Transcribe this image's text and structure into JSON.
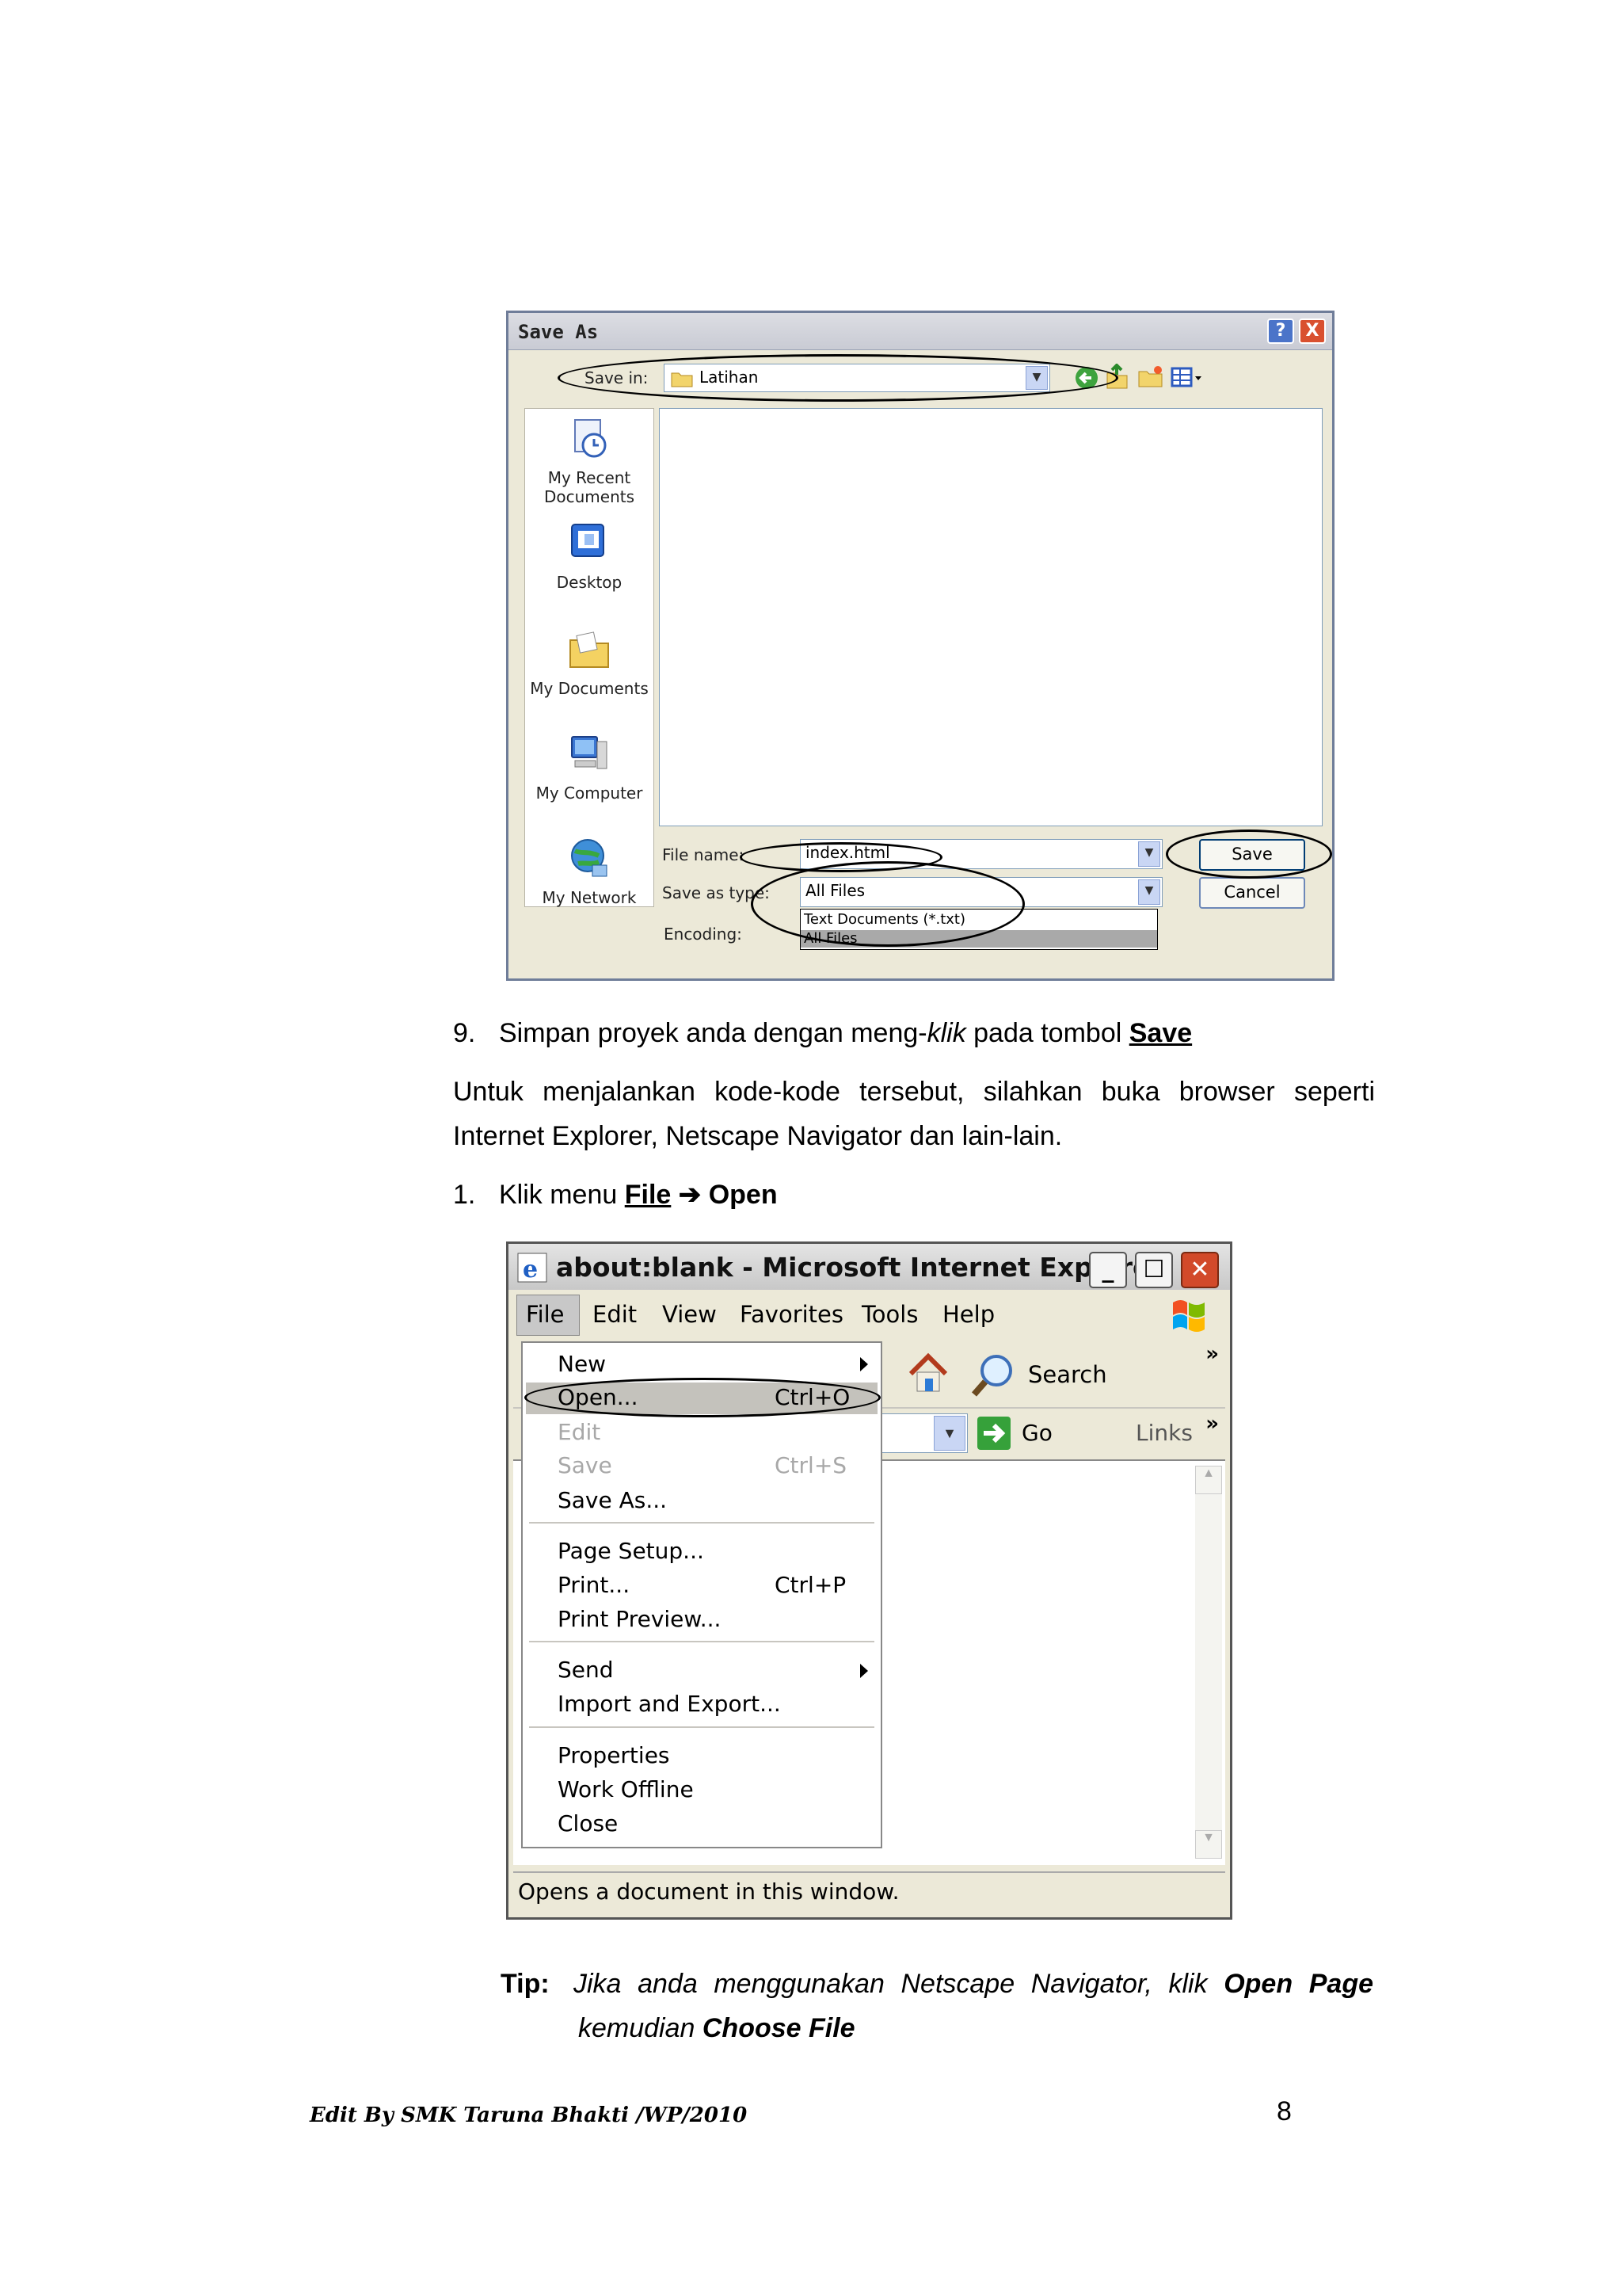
{
  "save_dialog": {
    "title": "Save As",
    "help_btn": "?",
    "close_btn": "X",
    "save_in_label": "Save in:",
    "save_in_value": "Latihan",
    "places": [
      {
        "line1": "My Recent",
        "line2": "Documents"
      },
      {
        "line1": "Desktop",
        "line2": ""
      },
      {
        "line1": "My Documents",
        "line2": ""
      },
      {
        "line1": "My Computer",
        "line2": ""
      },
      {
        "line1": "My Network",
        "line2": ""
      }
    ],
    "file_name_label": "File name:",
    "file_name_value": "index.html",
    "save_type_label": "Save as type:",
    "save_type_value": "All Files",
    "type_options": [
      "Text Documents (*.txt)",
      "All Files"
    ],
    "encoding_label": "Encoding:",
    "save_button": "Save",
    "cancel_button": "Cancel"
  },
  "text": {
    "step9_num": "9.",
    "step9_a": "Simpan proyek anda dengan meng-",
    "step9_klik": "klik",
    "step9_b": " pada tombol ",
    "step9_save": "Save",
    "para_line1": "Untuk menjalankan kode-kode tersebut, silahkan buka browser seperti",
    "para_line2": "Internet Explorer, Netscape Navigator dan lain-lain.",
    "step1_num": "1.",
    "step1_a": "Klik menu ",
    "step1_file": "File",
    "step1_arrow": "➔",
    "step1_open": "Open",
    "tip_label": "Tip:",
    "tip_line1": "Jika anda menggunakan Netscape Navigator, klik",
    "tip_open_page": "Open Page",
    "tip_line2_a": "kemudian",
    "tip_choose": "Choose File"
  },
  "ie_window": {
    "title": "about:blank - Microsoft Internet Explorer",
    "menu": [
      "File",
      "Edit",
      "View",
      "Favorites",
      "Tools",
      "Help"
    ],
    "search_label": "Search",
    "go_label": "Go",
    "links_label": "Links",
    "chevron": "»",
    "file_menu": {
      "new": "New",
      "open": "Open...",
      "open_sc": "Ctrl+O",
      "edit": "Edit",
      "save": "Save",
      "save_sc": "Ctrl+S",
      "save_as": "Save As...",
      "page_setup": "Page Setup...",
      "print": "Print...",
      "print_sc": "Ctrl+P",
      "print_preview": "Print Preview...",
      "send": "Send",
      "import_export": "Import and Export...",
      "properties": "Properties",
      "work_offline": "Work Offline",
      "close": "Close"
    },
    "status": "Opens a document in this window."
  },
  "footer": {
    "credit": "Edit By SMK Taruna Bhakti /WP/2010",
    "page": "8"
  }
}
